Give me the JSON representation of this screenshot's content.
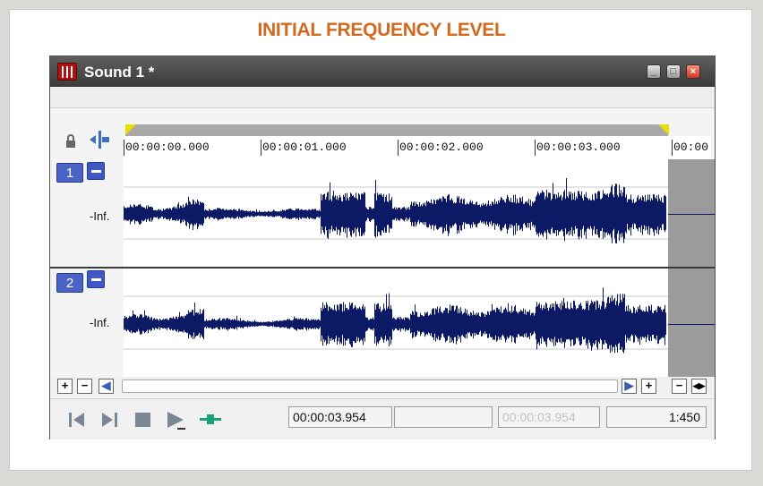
{
  "page": {
    "title": "INITIAL FREQUENCY LEVEL"
  },
  "window": {
    "title": "Sound 1 *",
    "icons": {
      "app": "wave-file-icon",
      "minimize": "minimize-icon",
      "maximize": "maximize-icon",
      "close": "close-icon"
    }
  },
  "toolbar": {
    "lock_icon": "lock-icon",
    "snap_icon": "snap-icon"
  },
  "ruler": {
    "labels": [
      "00:00:00.000",
      "00:00:01.000",
      "00:00:02.000",
      "00:00:03.000",
      "00:00"
    ]
  },
  "tracks": [
    {
      "number": "1",
      "level_label": "-Inf."
    },
    {
      "number": "2",
      "level_label": "-Inf."
    }
  ],
  "scroll": {
    "zoom_in": "+",
    "zoom_out": "−",
    "zoom_in_right": "+",
    "zoom_out_right": "−"
  },
  "transport": {
    "icons": [
      "go-to-start-icon",
      "go-to-end-icon",
      "stop-icon",
      "play-icon",
      "loop-icon"
    ],
    "cursor_time": "00:00:03.954",
    "selection_start": "",
    "selection_end": "00:00:03.954",
    "zoom_ratio": "1:450"
  },
  "colors": {
    "waveform": "#0c1a66",
    "title": "#d2691e",
    "track_button": "#4b63c7"
  }
}
